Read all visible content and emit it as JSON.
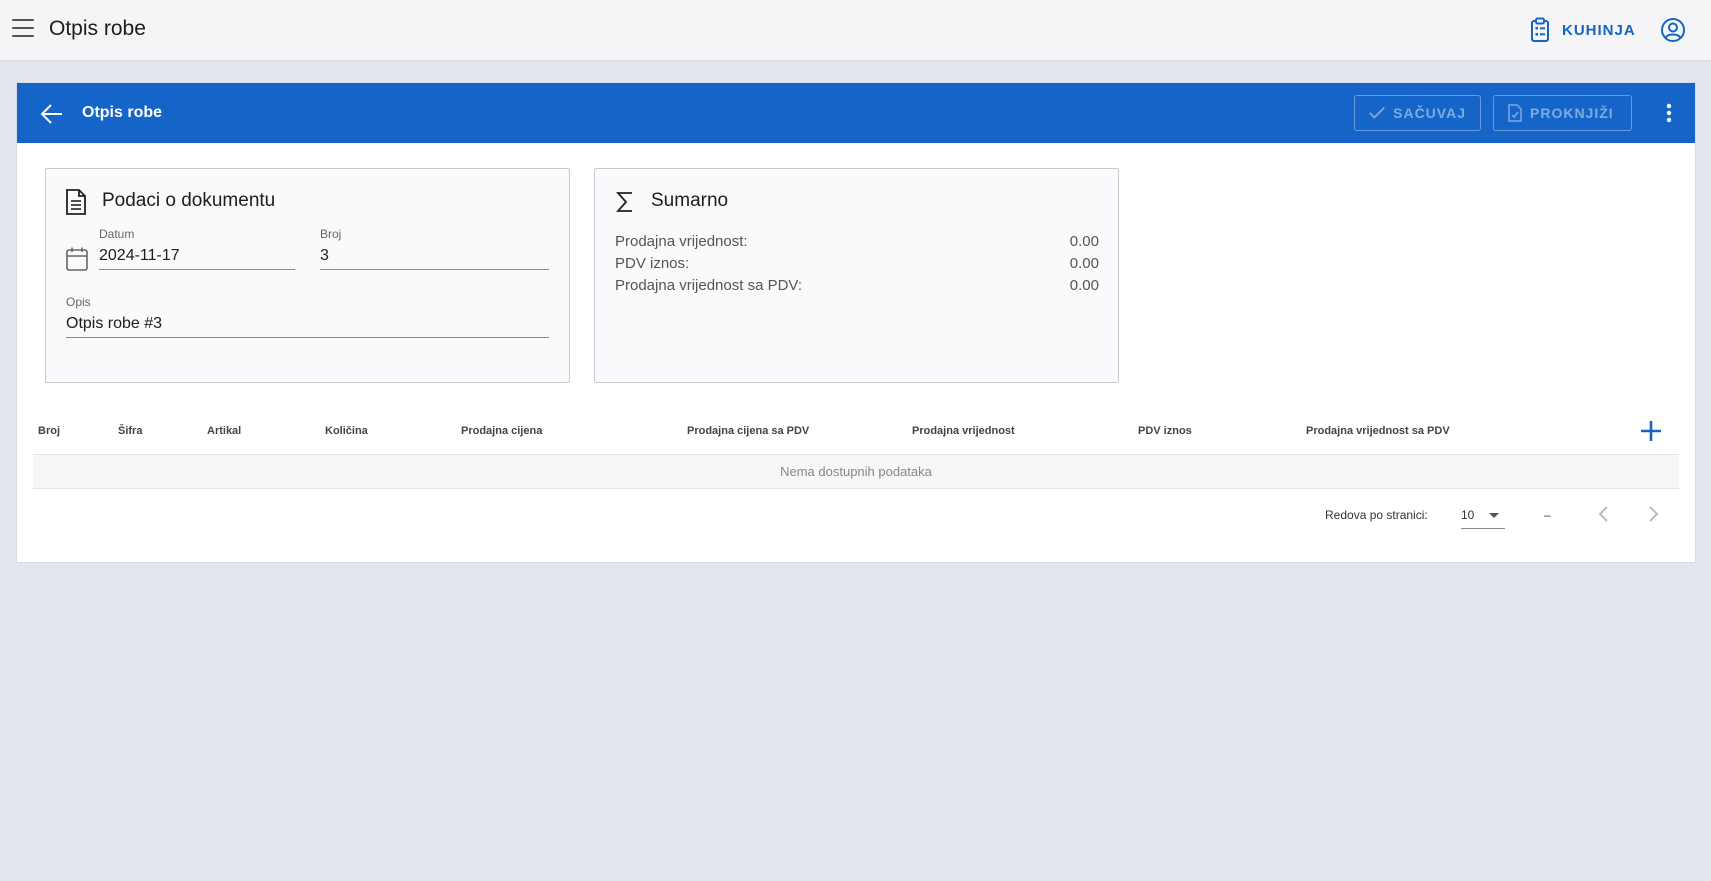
{
  "appbar": {
    "title": "Otpis robe",
    "location_label": "KUHINJA",
    "icons": {
      "menu": "hamburger-icon",
      "location": "clipboard-list-icon",
      "user": "account-circle-icon"
    }
  },
  "card": {
    "title": "Otpis robe",
    "save_label": "SAČUVAJ",
    "post_label": "PROKNJIŽI",
    "header_color": "#1565c8"
  },
  "document": {
    "title": "Podaci o dokumentu",
    "date_label": "Datum",
    "date_value": "2024-11-17",
    "number_label": "Broj",
    "number_value": "3",
    "description_label": "Opis",
    "description_value": "Otpis robe #3"
  },
  "summary": {
    "title": "Sumarno",
    "rows": [
      {
        "label": "Prodajna vrijednost:",
        "value": "0.00"
      },
      {
        "label": "PDV iznos:",
        "value": "0.00"
      },
      {
        "label": "Prodajna vrijednost sa PDV:",
        "value": "0.00"
      }
    ]
  },
  "table": {
    "columns": [
      "Broj",
      "Šifra",
      "Artikal",
      "Količina",
      "Prodajna cijena",
      "Prodajna cijena sa PDV",
      "Prodajna vrijednost",
      "PDV iznos",
      "Prodajna vrijednost sa PDV"
    ],
    "empty_text": "Nema dostupnih podataka"
  },
  "pagination": {
    "rows_per_page_label": "Redova po stranici:",
    "rows_per_page_value": "10",
    "range_text": "–"
  }
}
